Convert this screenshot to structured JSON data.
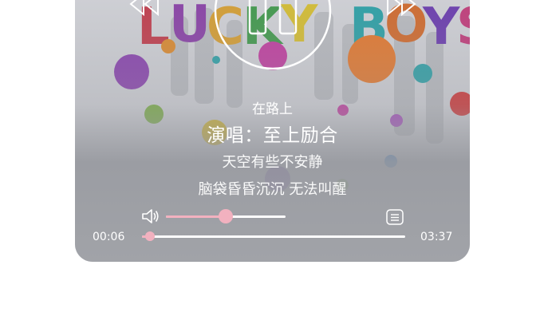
{
  "player": {
    "album_art_text": "LUCKY BOYS",
    "song_title": "在路上",
    "artist_line": "演唱：至上励合",
    "lyrics": [
      "天空有些不安静",
      "脑袋昏昏沉沉 无法叫醒"
    ],
    "volume_level": 0.5,
    "progress_fraction": 0.03,
    "current_time": "00:06",
    "total_time": "03:37",
    "accent_color": "#f2b1bf",
    "icons": [
      "previous-icon",
      "pause-icon",
      "next-icon",
      "volume-icon",
      "playlist-icon"
    ]
  }
}
